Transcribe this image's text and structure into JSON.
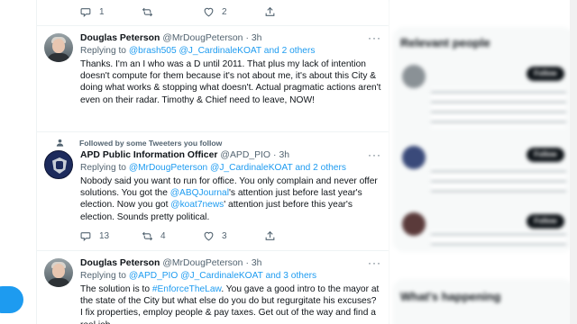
{
  "top_actions": {
    "reply_count": "1",
    "retweet_count": "",
    "like_count": "2"
  },
  "tweets": [
    {
      "name": "Douglas Peterson",
      "handle": "@MrDougPeterson",
      "time": "3h",
      "replying_prefix": "Replying to",
      "replying_to": "@brash505 @J_CardinaleKOAT and 2 others",
      "body": "Thanks. I'm an I who was a D until 2011. That plus my lack of intention doesn't compute for them because it's not about me, it's about this City & doing what works & stopping what doesn't. Actual pragmatic actions aren't even on their radar. Timothy & Chief need to leave, NOW!"
    },
    {
      "social_context": "Followed by some Tweeters you follow",
      "name": "APD Public Information Officer",
      "handle": "@APD_PIO",
      "time": "3h",
      "replying_prefix": "Replying to",
      "replying_to": "@MrDougPeterson @J_CardinaleKOAT and 2 others",
      "body_1": "Nobody said you want to run for office. You only complain and never offer solutions. You got the ",
      "body_link_1": "@ABQJournal",
      "body_2": "'s attention just before last year's election. Now you got ",
      "body_link_2": "@koat7news",
      "body_3": "' attention just before this year's election. Sounds pretty political.",
      "reply_count": "13",
      "retweet_count": "4",
      "like_count": "3"
    },
    {
      "name": "Douglas Peterson",
      "handle": "@MrDougPeterson",
      "time": "3h",
      "replying_prefix": "Replying to",
      "replying_to": "@APD_PIO @J_CardinaleKOAT and 3 others",
      "body_1": "The solution is to ",
      "body_link_1": "#EnforceTheLaw",
      "body_2": ". You gave a good intro to the mayor at the state of the City but what else do you do but regurgitate his excuses? I fix properties, employ people & pay taxes. Get out of the way and find a real job."
    }
  ],
  "sidebar": {
    "relevant_title": "Relevant people",
    "happening_title": "What's happening",
    "follow_label": "Follow"
  },
  "colors": {
    "accent": "#1d9bf0",
    "text": "#0f1419",
    "muted": "#536471"
  }
}
